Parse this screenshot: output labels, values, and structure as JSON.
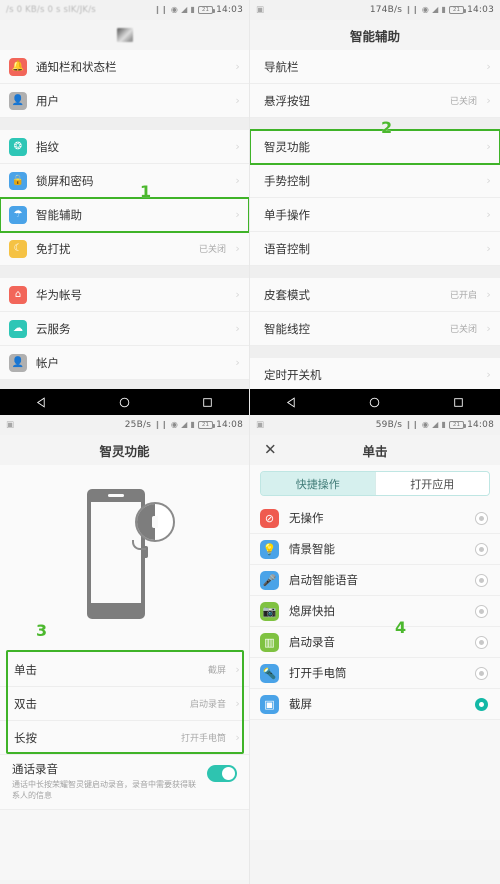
{
  "panel1": {
    "status": {
      "left_blur": "/s 0 KB/s  0 s  sIK/JK/s",
      "speed": "",
      "clock": "14:03"
    },
    "title": "",
    "groups": [
      {
        "rows": [
          {
            "label": "通知栏和状态栏",
            "value": "",
            "icon": "bell-icon",
            "color": "#f2665a",
            "glyph": "⬤"
          },
          {
            "label": "用户",
            "value": "",
            "icon": "user-icon",
            "color": "#b0b0b0",
            "glyph": "⬤"
          }
        ]
      },
      {
        "rows": [
          {
            "label": "指纹",
            "value": "",
            "icon": "fingerprint-icon",
            "color": "#2ec6b6",
            "glyph": "⬤"
          },
          {
            "label": "锁屏和密码",
            "value": "",
            "icon": "lock-icon",
            "color": "#4aa3e8",
            "glyph": "⬤"
          },
          {
            "label": "智能辅助",
            "value": "",
            "icon": "smart-assist-icon",
            "color": "#4aa3e8",
            "glyph": "⬤",
            "highlight": true
          },
          {
            "label": "免打扰",
            "value": "已关闭",
            "icon": "moon-icon",
            "color": "#f5c244",
            "glyph": "⬤"
          }
        ]
      },
      {
        "rows": [
          {
            "label": "华为帐号",
            "value": "",
            "icon": "huawei-account-icon",
            "color": "#f2665a",
            "glyph": "⬤"
          },
          {
            "label": "云服务",
            "value": "",
            "icon": "cloud-icon",
            "color": "#2ec6b6",
            "glyph": "⬤"
          },
          {
            "label": "帐户",
            "value": "",
            "icon": "account-icon",
            "color": "#b0b0b0",
            "glyph": "⬤"
          }
        ]
      },
      {
        "rows": [
          {
            "label": "",
            "value": "",
            "icon": "app-icon",
            "color": "#f2665a",
            "glyph": "⬤"
          }
        ]
      }
    ],
    "marker": "1"
  },
  "panel2": {
    "status": {
      "speed": "174B/s",
      "clock": "14:03"
    },
    "title": "智能辅助",
    "groups": [
      {
        "rows": [
          {
            "label": "导航栏",
            "value": ""
          },
          {
            "label": "悬浮按钮",
            "value": "已关闭"
          }
        ]
      },
      {
        "rows": [
          {
            "label": "智灵功能",
            "value": "",
            "highlight": true
          },
          {
            "label": "手势控制",
            "value": ""
          },
          {
            "label": "单手操作",
            "value": ""
          },
          {
            "label": "语音控制",
            "value": ""
          }
        ]
      },
      {
        "rows": [
          {
            "label": "皮套模式",
            "value": "已开启"
          },
          {
            "label": "智能线控",
            "value": "已关闭"
          }
        ]
      },
      {
        "rows": [
          {
            "label": "定时开关机",
            "value": ""
          }
        ]
      }
    ],
    "marker": "2"
  },
  "panel3": {
    "status": {
      "speed": "25B/s",
      "clock": "14:08"
    },
    "title": "智灵功能",
    "rows": [
      {
        "label": "单击",
        "value": "截屏"
      },
      {
        "label": "双击",
        "value": "启动录音"
      },
      {
        "label": "长按",
        "value": "打开手电筒"
      }
    ],
    "toggle": {
      "title": "通话录音",
      "desc": "通话中长按荣耀智灵键启动录音，录音中需要获得联系人的信息",
      "state": "on"
    },
    "marker": "3"
  },
  "panel4": {
    "status": {
      "speed": "59B/s",
      "clock": "14:08"
    },
    "title": "单击",
    "close_label": "✕",
    "tabs": [
      {
        "label": "快捷操作",
        "active": true
      },
      {
        "label": "打开应用",
        "active": false
      }
    ],
    "options": [
      {
        "label": "无操作",
        "icon": "no-action-icon",
        "color": "#ef5a4f",
        "glyph": "⊘",
        "selected": false
      },
      {
        "label": "情景智能",
        "icon": "bulb-icon",
        "color": "#4aa3e8",
        "glyph": "●",
        "selected": false
      },
      {
        "label": "启动智能语音",
        "icon": "mic-icon",
        "color": "#4aa3e8",
        "glyph": "●",
        "selected": false
      },
      {
        "label": "熄屏快拍",
        "icon": "camera-icon",
        "color": "#7fc241",
        "glyph": "●",
        "selected": false
      },
      {
        "label": "启动录音",
        "icon": "recorder-icon",
        "color": "#7fc241",
        "glyph": "▮",
        "selected": false
      },
      {
        "label": "打开手电筒",
        "icon": "flashlight-icon",
        "color": "#4aa3e8",
        "glyph": "▬",
        "selected": false
      },
      {
        "label": "截屏",
        "icon": "screenshot-icon",
        "color": "#4aa3e8",
        "glyph": "▣",
        "selected": true
      }
    ],
    "marker": "4"
  },
  "navbar": {
    "back": "back-triangle",
    "home": "home-circle",
    "recents": "recents-square"
  },
  "colors": {
    "highlight": "#3fb328",
    "marker": "#4cb82e",
    "accent": "#14b8a6",
    "tab_active_bg": "#d6f0ee"
  }
}
